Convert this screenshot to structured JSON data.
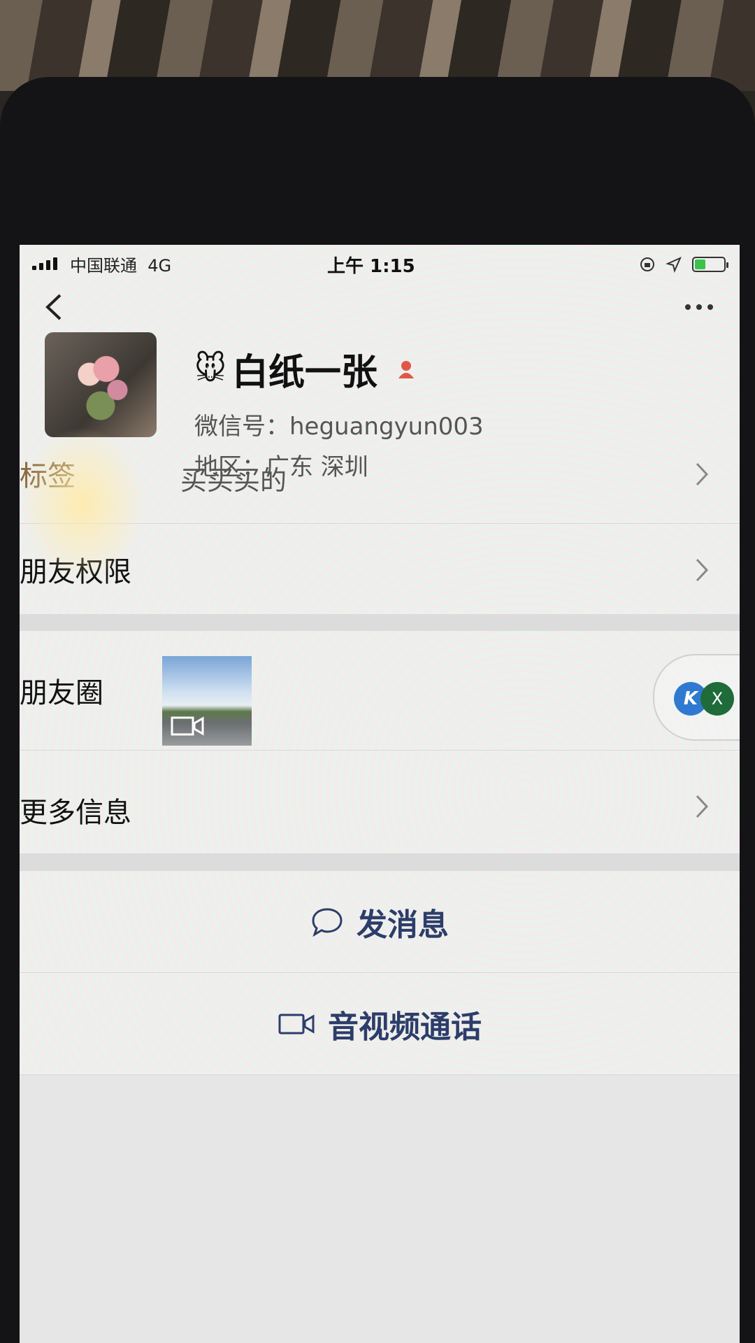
{
  "status_bar": {
    "carrier": "中国联通",
    "network": "4G",
    "time": "上午 1:15"
  },
  "profile": {
    "emoji": "🐭",
    "nickname": "白纸一张",
    "wechat_id": "微信号：heguangyun003",
    "region": "地区：广东 深圳"
  },
  "rows": {
    "tags_label": "标签",
    "tags_value": "买买买的",
    "permissions_label": "朋友权限",
    "moments_label": "朋友圈",
    "more_info_label": "更多信息"
  },
  "floating_badges": {
    "first": "K",
    "second": "X"
  },
  "actions": {
    "send_message": "发消息",
    "av_call": "音视频通话"
  },
  "colors": {
    "action_text": "#2d3d6a",
    "tag_label": "#8a6a40",
    "battery_fill": "#3ac34a",
    "pin": "#e0574a"
  }
}
